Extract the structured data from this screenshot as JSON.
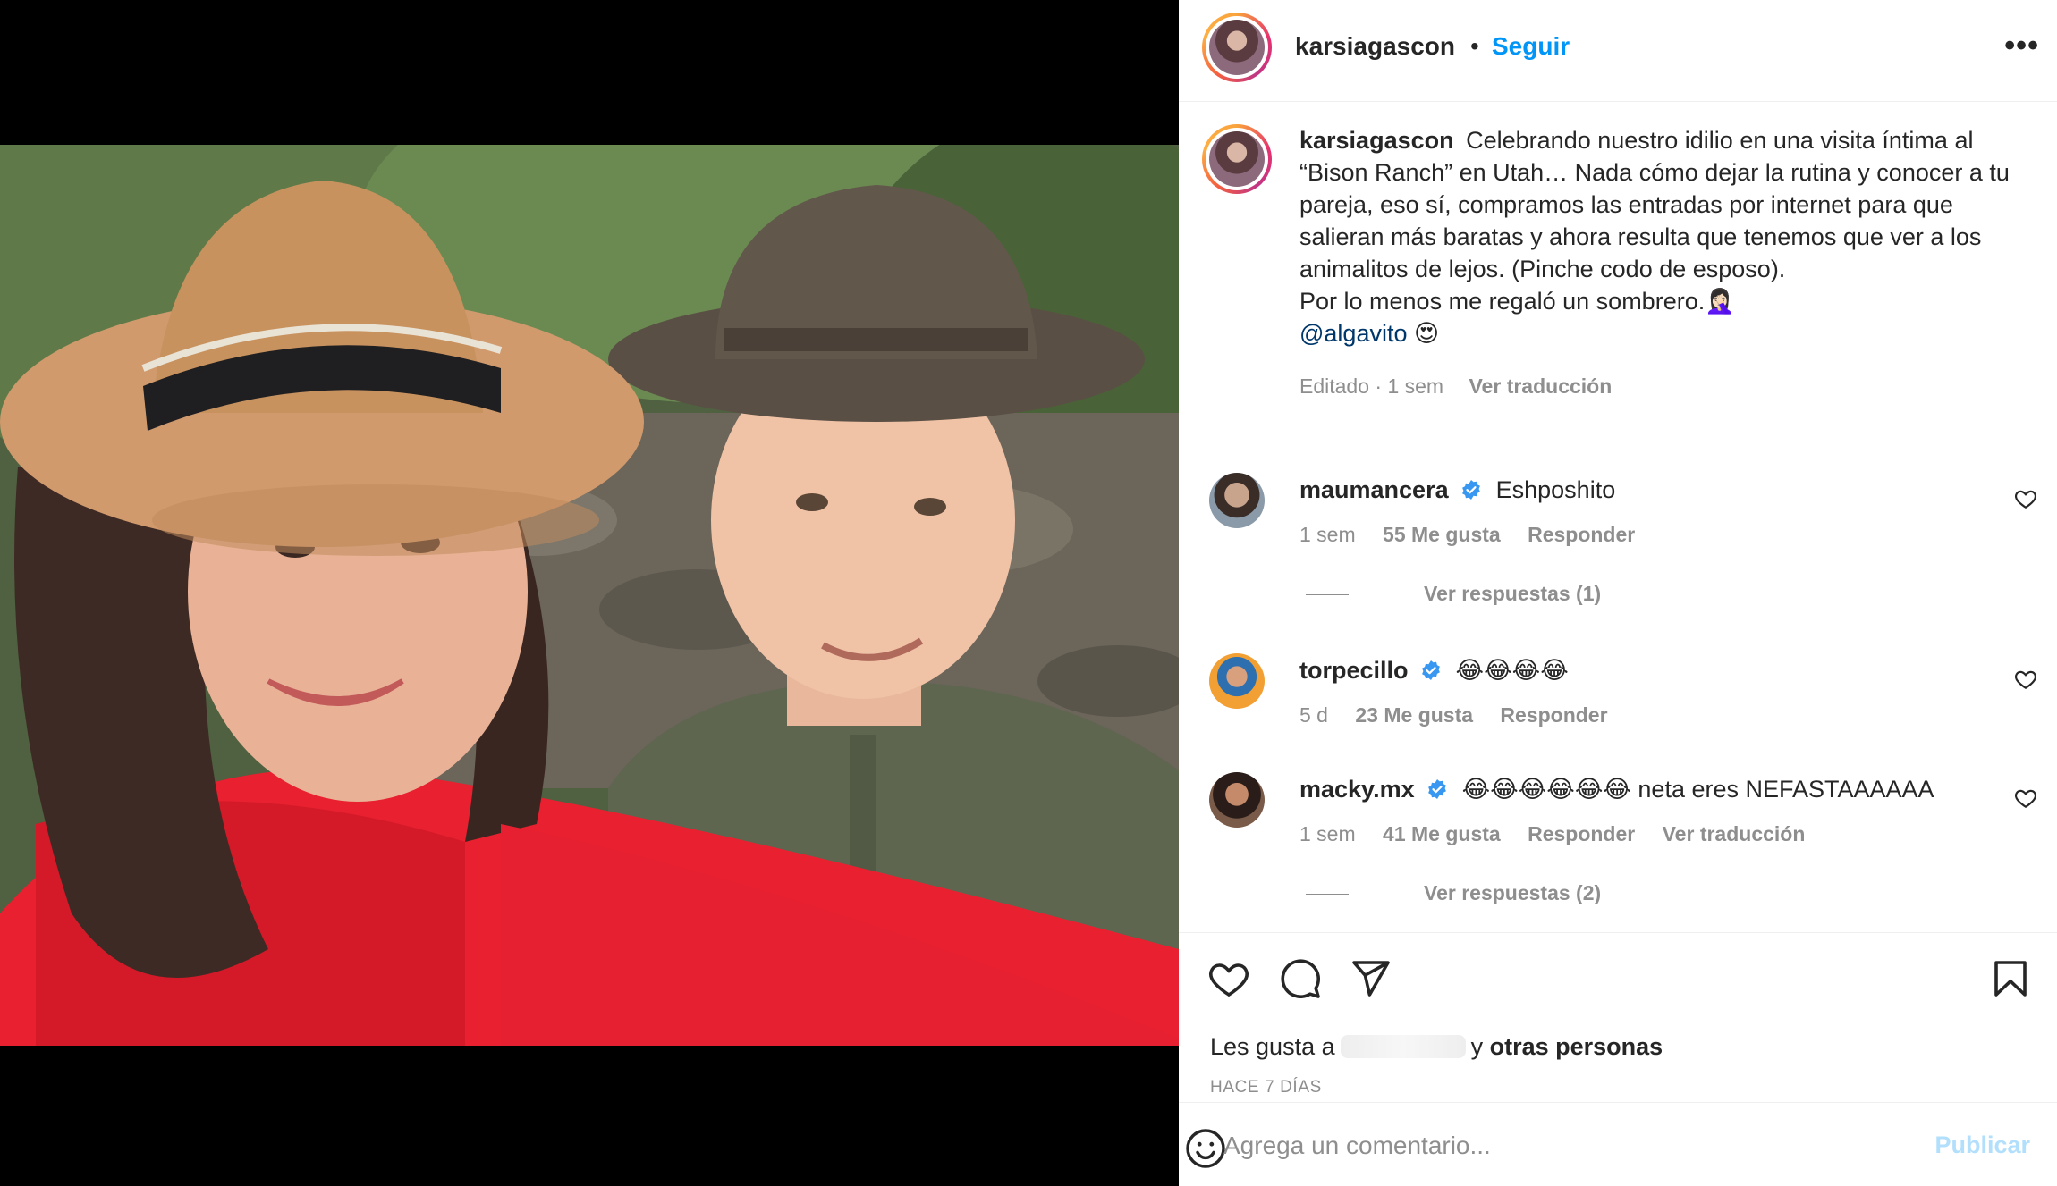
{
  "post": {
    "author": "karsiagascon",
    "separator": "•",
    "follow_label": "Seguir",
    "more_label": "•••"
  },
  "caption": {
    "author": "karsiagascon",
    "text": "Celebrando nuestro idilio en una visita íntima al “Bison Ranch” en Utah… Nada cómo dejar la rutina y conocer a tu pareja, eso sí, compramos las entradas por internet para que salieran más baratas y ahora resulta que tenemos que ver a los animalitos de lejos. (Pinche codo de esposo).",
    "line2": "Por lo menos me regaló un sombrero.🤦🏻‍♀️",
    "mention": "@algavito",
    "mention_emoji": "😍",
    "edited": "Editado · 1 sem",
    "translate": "Ver traducción"
  },
  "comments": [
    {
      "user": "maumancera",
      "text": "Eshposhito",
      "time": "1 sem",
      "likes": "55 Me gusta",
      "reply": "Responder",
      "replies": "Ver respuestas (1)"
    },
    {
      "user": "torpecillo",
      "text": "😂😂😂😂",
      "time": "5 d",
      "likes": "23 Me gusta",
      "reply": "Responder"
    },
    {
      "user": "macky.mx",
      "text": "😂😂😂😂😂😂 neta eres NEFASTAAAAAA",
      "time": "1 sem",
      "likes": "41 Me gusta",
      "reply": "Responder",
      "translate": "Ver traducción",
      "replies": "Ver respuestas (2)"
    }
  ],
  "likes": {
    "prefix": "Les gusta a",
    "suffix": "y",
    "others": "otras personas"
  },
  "date": "HACE 7 DÍAS",
  "composer": {
    "placeholder": "Agrega un comentario...",
    "publish": "Publicar"
  },
  "icons": {
    "like": "heart-outline-icon",
    "comment": "speech-bubble-icon",
    "share": "paper-plane-icon",
    "save": "bookmark-icon",
    "emoji": "smiley-icon",
    "verified": "verified-badge-icon"
  },
  "colors": {
    "link_blue": "#0095f6",
    "verified_blue": "#3897f0",
    "publish_disabled": "#b2dffc",
    "muted": "#8e8e8e"
  }
}
